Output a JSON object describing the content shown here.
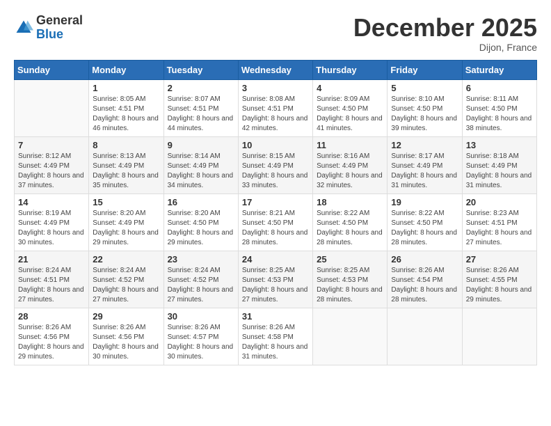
{
  "header": {
    "logo_general": "General",
    "logo_blue": "Blue",
    "month_title": "December 2025",
    "location": "Dijon, France"
  },
  "days_of_week": [
    "Sunday",
    "Monday",
    "Tuesday",
    "Wednesday",
    "Thursday",
    "Friday",
    "Saturday"
  ],
  "weeks": [
    [
      {
        "day": "",
        "sunrise": "",
        "sunset": "",
        "daylight": ""
      },
      {
        "day": "1",
        "sunrise": "Sunrise: 8:05 AM",
        "sunset": "Sunset: 4:51 PM",
        "daylight": "Daylight: 8 hours and 46 minutes."
      },
      {
        "day": "2",
        "sunrise": "Sunrise: 8:07 AM",
        "sunset": "Sunset: 4:51 PM",
        "daylight": "Daylight: 8 hours and 44 minutes."
      },
      {
        "day": "3",
        "sunrise": "Sunrise: 8:08 AM",
        "sunset": "Sunset: 4:51 PM",
        "daylight": "Daylight: 8 hours and 42 minutes."
      },
      {
        "day": "4",
        "sunrise": "Sunrise: 8:09 AM",
        "sunset": "Sunset: 4:50 PM",
        "daylight": "Daylight: 8 hours and 41 minutes."
      },
      {
        "day": "5",
        "sunrise": "Sunrise: 8:10 AM",
        "sunset": "Sunset: 4:50 PM",
        "daylight": "Daylight: 8 hours and 39 minutes."
      },
      {
        "day": "6",
        "sunrise": "Sunrise: 8:11 AM",
        "sunset": "Sunset: 4:50 PM",
        "daylight": "Daylight: 8 hours and 38 minutes."
      }
    ],
    [
      {
        "day": "7",
        "sunrise": "Sunrise: 8:12 AM",
        "sunset": "Sunset: 4:49 PM",
        "daylight": "Daylight: 8 hours and 37 minutes."
      },
      {
        "day": "8",
        "sunrise": "Sunrise: 8:13 AM",
        "sunset": "Sunset: 4:49 PM",
        "daylight": "Daylight: 8 hours and 35 minutes."
      },
      {
        "day": "9",
        "sunrise": "Sunrise: 8:14 AM",
        "sunset": "Sunset: 4:49 PM",
        "daylight": "Daylight: 8 hours and 34 minutes."
      },
      {
        "day": "10",
        "sunrise": "Sunrise: 8:15 AM",
        "sunset": "Sunset: 4:49 PM",
        "daylight": "Daylight: 8 hours and 33 minutes."
      },
      {
        "day": "11",
        "sunrise": "Sunrise: 8:16 AM",
        "sunset": "Sunset: 4:49 PM",
        "daylight": "Daylight: 8 hours and 32 minutes."
      },
      {
        "day": "12",
        "sunrise": "Sunrise: 8:17 AM",
        "sunset": "Sunset: 4:49 PM",
        "daylight": "Daylight: 8 hours and 31 minutes."
      },
      {
        "day": "13",
        "sunrise": "Sunrise: 8:18 AM",
        "sunset": "Sunset: 4:49 PM",
        "daylight": "Daylight: 8 hours and 31 minutes."
      }
    ],
    [
      {
        "day": "14",
        "sunrise": "Sunrise: 8:19 AM",
        "sunset": "Sunset: 4:49 PM",
        "daylight": "Daylight: 8 hours and 30 minutes."
      },
      {
        "day": "15",
        "sunrise": "Sunrise: 8:20 AM",
        "sunset": "Sunset: 4:49 PM",
        "daylight": "Daylight: 8 hours and 29 minutes."
      },
      {
        "day": "16",
        "sunrise": "Sunrise: 8:20 AM",
        "sunset": "Sunset: 4:50 PM",
        "daylight": "Daylight: 8 hours and 29 minutes."
      },
      {
        "day": "17",
        "sunrise": "Sunrise: 8:21 AM",
        "sunset": "Sunset: 4:50 PM",
        "daylight": "Daylight: 8 hours and 28 minutes."
      },
      {
        "day": "18",
        "sunrise": "Sunrise: 8:22 AM",
        "sunset": "Sunset: 4:50 PM",
        "daylight": "Daylight: 8 hours and 28 minutes."
      },
      {
        "day": "19",
        "sunrise": "Sunrise: 8:22 AM",
        "sunset": "Sunset: 4:50 PM",
        "daylight": "Daylight: 8 hours and 28 minutes."
      },
      {
        "day": "20",
        "sunrise": "Sunrise: 8:23 AM",
        "sunset": "Sunset: 4:51 PM",
        "daylight": "Daylight: 8 hours and 27 minutes."
      }
    ],
    [
      {
        "day": "21",
        "sunrise": "Sunrise: 8:24 AM",
        "sunset": "Sunset: 4:51 PM",
        "daylight": "Daylight: 8 hours and 27 minutes."
      },
      {
        "day": "22",
        "sunrise": "Sunrise: 8:24 AM",
        "sunset": "Sunset: 4:52 PM",
        "daylight": "Daylight: 8 hours and 27 minutes."
      },
      {
        "day": "23",
        "sunrise": "Sunrise: 8:24 AM",
        "sunset": "Sunset: 4:52 PM",
        "daylight": "Daylight: 8 hours and 27 minutes."
      },
      {
        "day": "24",
        "sunrise": "Sunrise: 8:25 AM",
        "sunset": "Sunset: 4:53 PM",
        "daylight": "Daylight: 8 hours and 27 minutes."
      },
      {
        "day": "25",
        "sunrise": "Sunrise: 8:25 AM",
        "sunset": "Sunset: 4:53 PM",
        "daylight": "Daylight: 8 hours and 28 minutes."
      },
      {
        "day": "26",
        "sunrise": "Sunrise: 8:26 AM",
        "sunset": "Sunset: 4:54 PM",
        "daylight": "Daylight: 8 hours and 28 minutes."
      },
      {
        "day": "27",
        "sunrise": "Sunrise: 8:26 AM",
        "sunset": "Sunset: 4:55 PM",
        "daylight": "Daylight: 8 hours and 29 minutes."
      }
    ],
    [
      {
        "day": "28",
        "sunrise": "Sunrise: 8:26 AM",
        "sunset": "Sunset: 4:56 PM",
        "daylight": "Daylight: 8 hours and 29 minutes."
      },
      {
        "day": "29",
        "sunrise": "Sunrise: 8:26 AM",
        "sunset": "Sunset: 4:56 PM",
        "daylight": "Daylight: 8 hours and 30 minutes."
      },
      {
        "day": "30",
        "sunrise": "Sunrise: 8:26 AM",
        "sunset": "Sunset: 4:57 PM",
        "daylight": "Daylight: 8 hours and 30 minutes."
      },
      {
        "day": "31",
        "sunrise": "Sunrise: 8:26 AM",
        "sunset": "Sunset: 4:58 PM",
        "daylight": "Daylight: 8 hours and 31 minutes."
      },
      {
        "day": "",
        "sunrise": "",
        "sunset": "",
        "daylight": ""
      },
      {
        "day": "",
        "sunrise": "",
        "sunset": "",
        "daylight": ""
      },
      {
        "day": "",
        "sunrise": "",
        "sunset": "",
        "daylight": ""
      }
    ]
  ],
  "colors": {
    "header_bg": "#2a6db5",
    "header_text": "#ffffff",
    "row_even_bg": "#f5f5f5",
    "row_odd_bg": "#ffffff"
  }
}
